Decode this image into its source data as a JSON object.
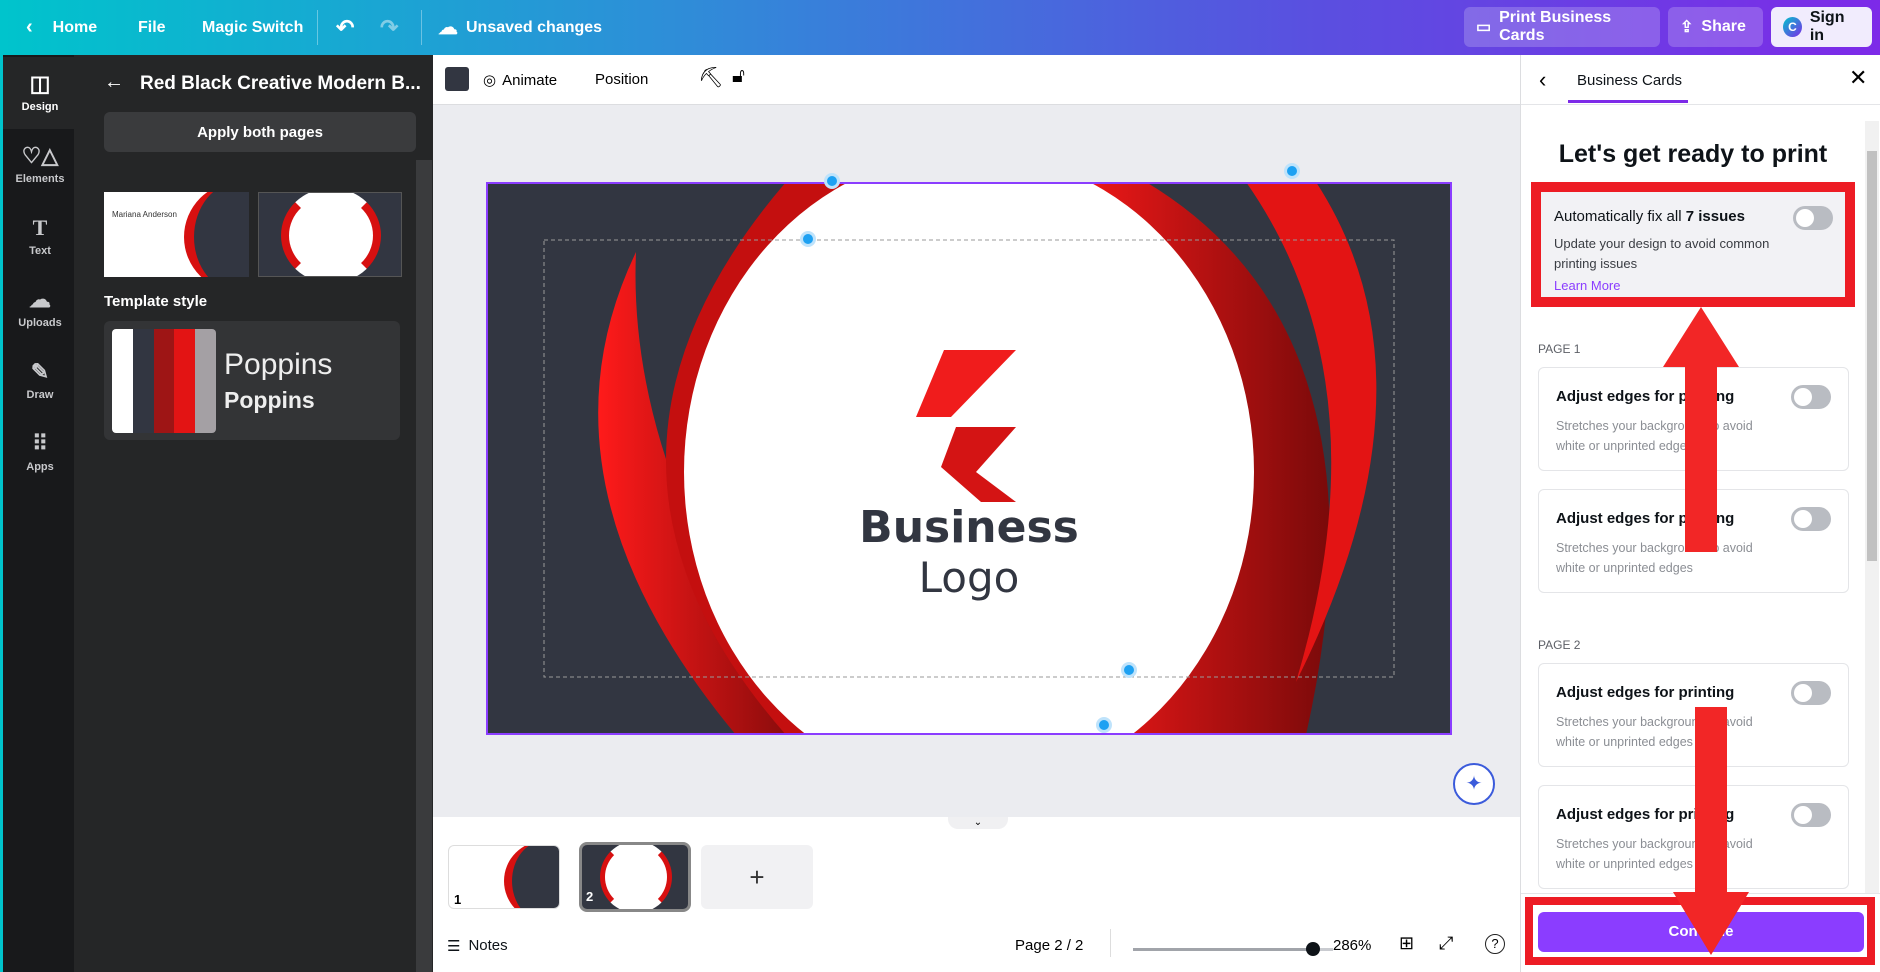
{
  "topbar": {
    "home": "Home",
    "file": "File",
    "magic_switch": "Magic Switch",
    "status": "Unsaved changes",
    "print": "Print Business Cards",
    "share": "Share",
    "signin": "Sign in"
  },
  "rail": [
    {
      "label": "Design",
      "icon": "layout-icon"
    },
    {
      "label": "Elements",
      "icon": "shapes-icon"
    },
    {
      "label": "Text",
      "icon": "text-icon"
    },
    {
      "label": "Uploads",
      "icon": "upload-cloud-icon"
    },
    {
      "label": "Draw",
      "icon": "pen-icon"
    },
    {
      "label": "Apps",
      "icon": "apps-grid-icon"
    }
  ],
  "panel": {
    "title": "Red Black Creative Modern B...",
    "apply": "Apply both pages",
    "template_style": "Template style",
    "font_regular": "Poppins",
    "font_bold": "Poppins",
    "palette": [
      "#ffffff",
      "#323641",
      "#9e1515",
      "#e31414",
      "#a4a0a4"
    ],
    "thumb_name": "Mariana Anderson"
  },
  "toolbar": {
    "animate": "Animate",
    "position": "Position",
    "color": "#323641"
  },
  "design": {
    "brand_line1": "Business",
    "brand_line2": "Logo"
  },
  "film": {
    "pages": [
      "1",
      "2"
    ],
    "add": "+"
  },
  "bottom": {
    "notes": "Notes",
    "page": "Page 2 / 2",
    "zoom": "286%",
    "zoom_fraction": 0.9
  },
  "right": {
    "tab": "Business Cards",
    "heading": "Let's get ready to print",
    "autofix_prefix": "Automatically fix all ",
    "autofix_bold": "7 issues",
    "autofix_desc": "Update your design to avoid common printing issues",
    "learn_more": "Learn More",
    "page1": "PAGE 1",
    "page2": "PAGE 2",
    "items": [
      {
        "title": "Adjust edges for printing",
        "desc": "Stretches your background to avoid white or unprinted edges"
      },
      {
        "title": "Adjust edges for printing",
        "desc": "Stretches your background to avoid white or unprinted edges"
      },
      {
        "title": "Adjust edges for printing",
        "desc": "Stretches your background to avoid white or unprinted edges"
      },
      {
        "title": "Adjust edges for printing",
        "desc": "Stretches your background to avoid white or unprinted edges"
      }
    ],
    "continue": "Continue"
  }
}
